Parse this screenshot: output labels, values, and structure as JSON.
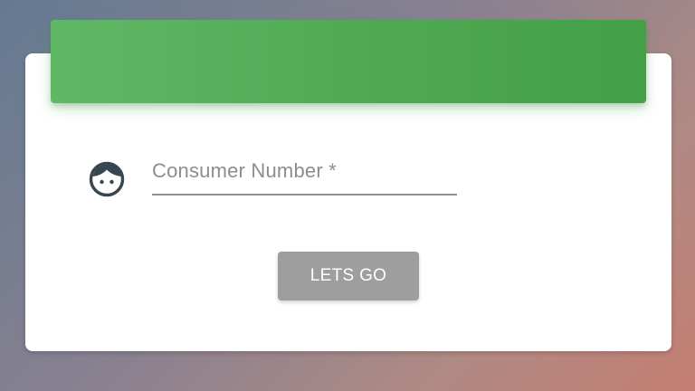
{
  "form": {
    "consumer_number_label": "Consumer Number *",
    "consumer_number_value": "",
    "submit_label": "LETS GO"
  },
  "icons": {
    "field_icon": "face-icon"
  },
  "colors": {
    "header_green": "#4caf50",
    "button_disabled": "#9e9e9e",
    "icon_dark": "#37474f"
  }
}
